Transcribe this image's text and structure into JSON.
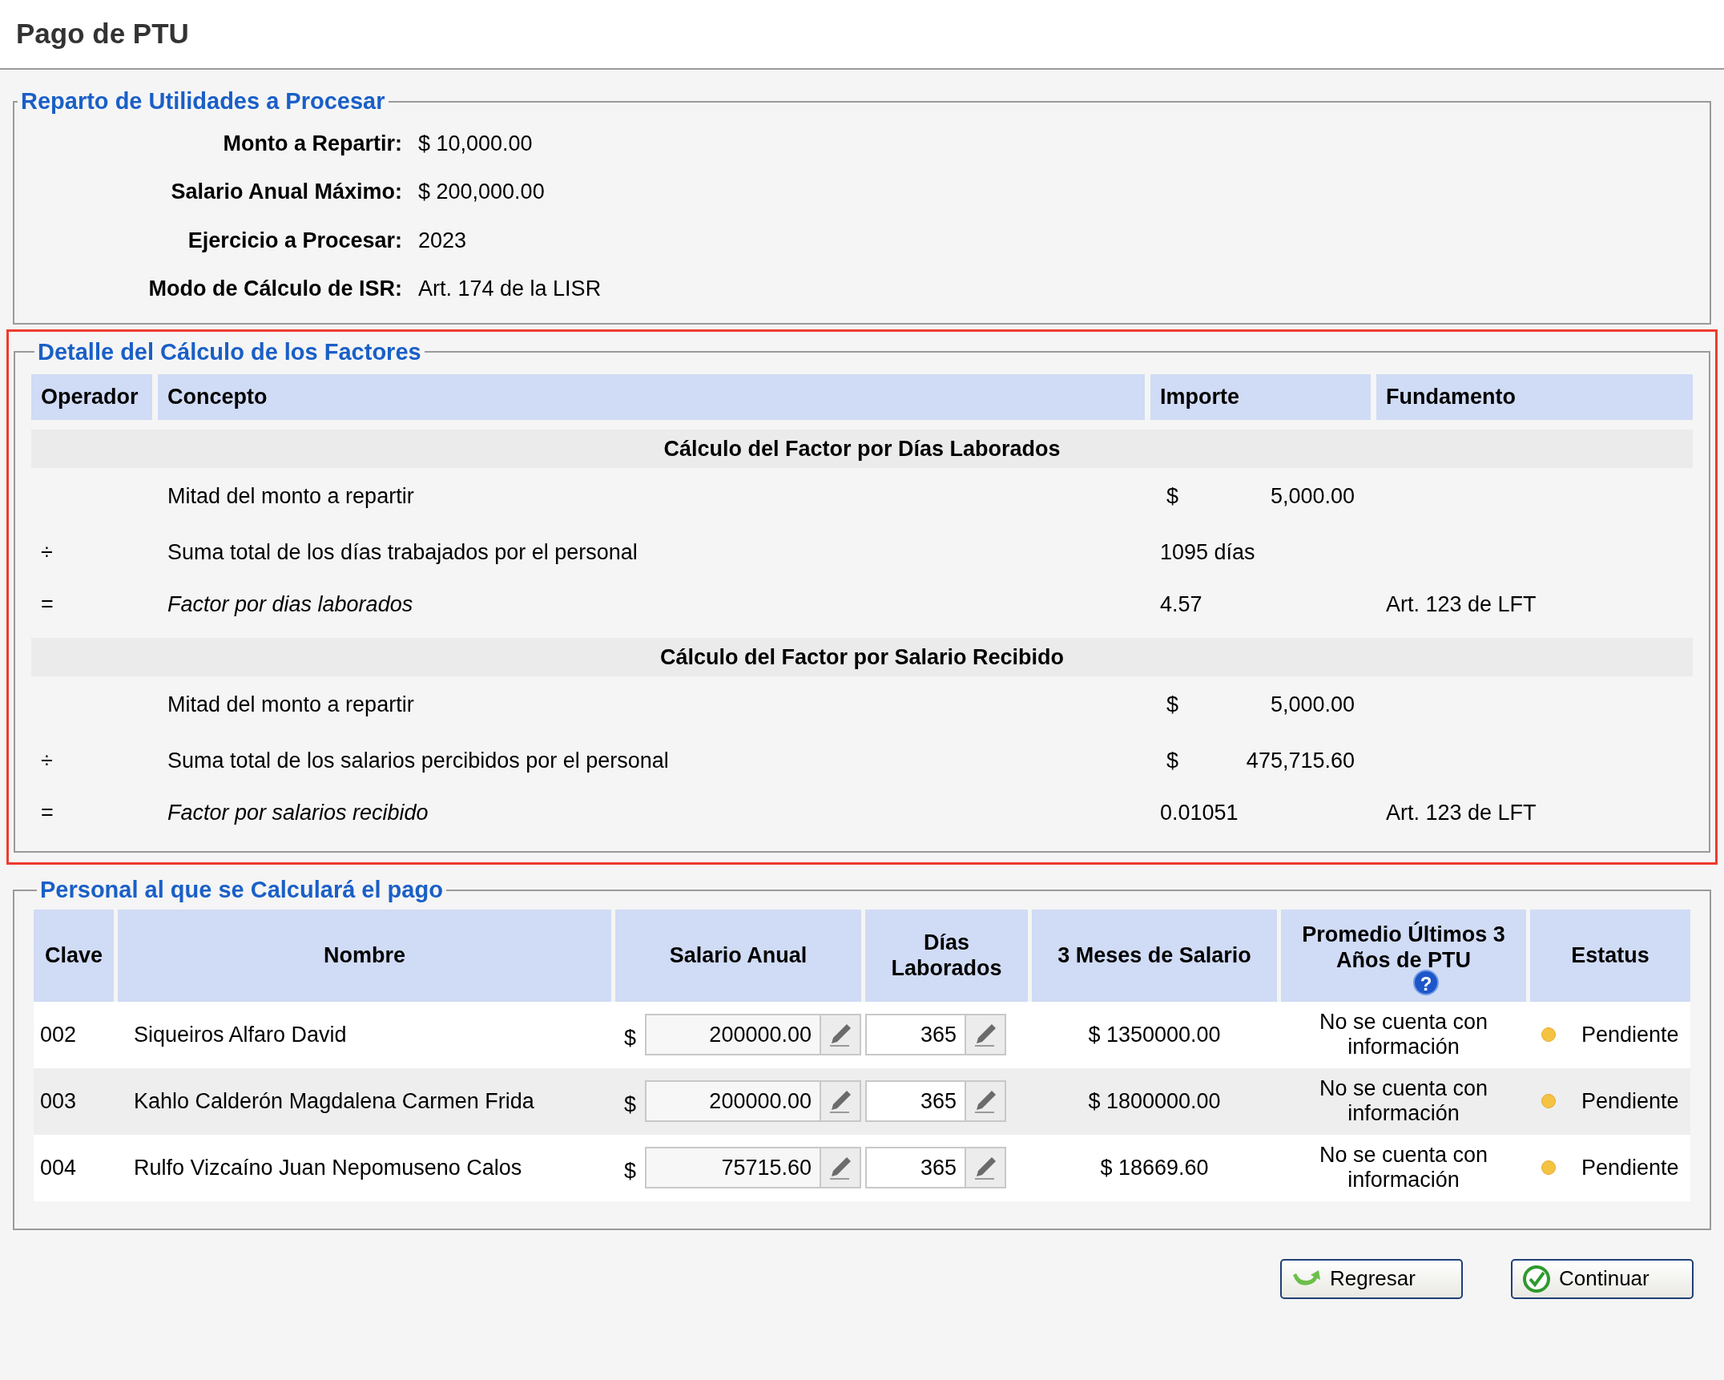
{
  "page_title": "Pago de PTU",
  "summary": {
    "title": "Reparto de Utilidades a Procesar",
    "fields": [
      {
        "label": "Monto a Repartir:",
        "value": "$ 10,000.00"
      },
      {
        "label": "Salario Anual Máximo:",
        "value": "$ 200,000.00"
      },
      {
        "label": "Ejercicio a Procesar:",
        "value": "2023"
      },
      {
        "label": "Modo de Cálculo de ISR:",
        "value": "Art. 174 de la LISR"
      }
    ]
  },
  "factors": {
    "title": "Detalle del Cálculo de los Factores",
    "highlighted": true,
    "columns": [
      "Operador",
      "Concepto",
      "Importe",
      "Fundamento"
    ],
    "rows": [
      {
        "kind": "group",
        "text": "Cálculo del Factor por Días Laborados"
      },
      {
        "kind": "line",
        "concept": "Mitad del monto a repartir",
        "currency": "$",
        "amount": "5,000.00"
      },
      {
        "kind": "line",
        "operator": "÷",
        "concept": "Suma total de los días trabajados por el personal",
        "amount": "1095 días"
      },
      {
        "kind": "result",
        "operator": "=",
        "concept": "Factor por dias laborados",
        "amount": "4.57",
        "basis": "Art. 123 de LFT"
      },
      {
        "kind": "group",
        "text": "Cálculo del Factor por Salario Recibido"
      },
      {
        "kind": "line",
        "concept": "Mitad del monto a repartir",
        "currency": "$",
        "amount": "5,000.00"
      },
      {
        "kind": "line",
        "operator": "÷",
        "concept": "Suma total de los salarios percibidos por el personal",
        "currency": "$",
        "amount": "475,715.60"
      },
      {
        "kind": "result",
        "operator": "=",
        "concept": "Factor por salarios recibido",
        "amount": "0.01051",
        "basis": "Art. 123 de LFT"
      }
    ]
  },
  "staff": {
    "title": "Personal al que se Calculará el pago",
    "columns": [
      "Clave",
      "Nombre",
      "Salario Anual",
      "Días Laborados",
      "3 Meses de Salario",
      "Promedio Últimos 3 Años de PTU",
      "Estatus"
    ],
    "help": "?",
    "rows": [
      {
        "clave": "002",
        "nombre": "Siqueiros Alfaro David",
        "currency": "$",
        "salario": "200000.00",
        "dias": "365",
        "tres_meses": "$ 1350000.00",
        "promedio": "No se cuenta con información",
        "estatus": "Pendiente",
        "color": "#f5c342"
      },
      {
        "clave": "003",
        "nombre": "Kahlo Calderón Magdalena Carmen Frida",
        "currency": "$",
        "salario": "200000.00",
        "dias": "365",
        "tres_meses": "$ 1800000.00",
        "promedio": "No se cuenta con información",
        "estatus": "Pendiente",
        "color": "#f5c342"
      },
      {
        "clave": "004",
        "nombre": "Rulfo Vizcaíno Juan Nepomuseno Calos",
        "currency": "$",
        "salario": "75715.60",
        "dias": "365",
        "tres_meses": "$ 18669.60",
        "promedio": "No se cuenta con información",
        "estatus": "Pendiente",
        "color": "#f5c342"
      }
    ]
  },
  "buttons": [
    {
      "kind": "back",
      "label": "Regresar"
    },
    {
      "kind": "continue",
      "label": "Continuar"
    }
  ]
}
